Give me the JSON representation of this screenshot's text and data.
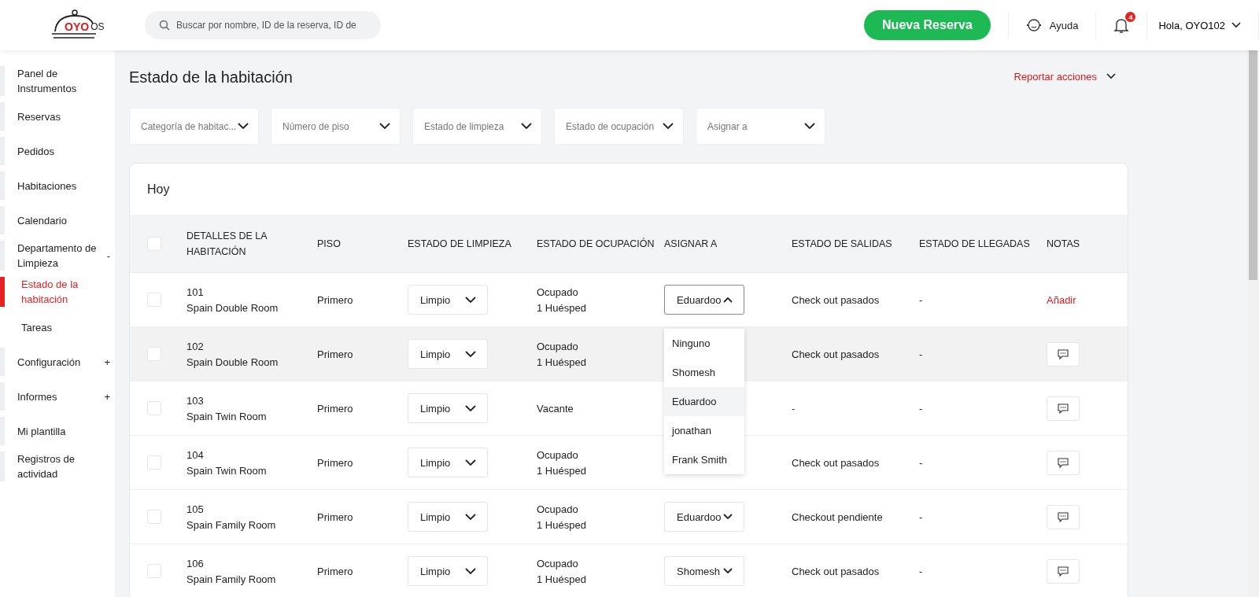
{
  "header": {
    "logo": {
      "brand": "OYO",
      "suffix": "OS"
    },
    "search": {
      "placeholder": "Buscar por nombre, ID de la reserva, ID de"
    },
    "new_booking_button": "Nueva Reserva",
    "help": "Ayuda",
    "notifications": {
      "badge": "4"
    },
    "user_menu": "Hola, OYO102"
  },
  "sidebar": {
    "items": [
      {
        "label": "Panel de Instrumentos",
        "selected": false
      },
      {
        "label": "Reservas",
        "selected": false
      },
      {
        "label": "Pedidos",
        "selected": false
      },
      {
        "label": "Habitaciones",
        "selected": false
      },
      {
        "label": "Calendario",
        "selected": false
      },
      {
        "label": "Departamento de Limpieza",
        "selected": false,
        "toggle": "-",
        "children": [
          {
            "label": "Estado de la habitación",
            "selected": true
          },
          {
            "label": "Tareas",
            "selected": false
          }
        ]
      },
      {
        "label": "Configuración",
        "selected": false,
        "toggle": "+"
      },
      {
        "label": "Informes",
        "selected": false,
        "toggle": "+"
      },
      {
        "label": "Mi plantilla",
        "selected": false
      },
      {
        "label": "Registros de actividad",
        "selected": false
      }
    ]
  },
  "page": {
    "title": "Estado de la habitación",
    "report_actions": "Reportar acciones",
    "filters": [
      {
        "placeholder": "Categoría de habitac..."
      },
      {
        "placeholder": "Número de piso"
      },
      {
        "placeholder": "Estado de limpieza"
      },
      {
        "placeholder": "Estado de ocupación"
      },
      {
        "placeholder": "Asignar a"
      }
    ],
    "card": {
      "title": "Hoy",
      "table": {
        "all_checked": false,
        "columns": [
          "DETALLES DE LA HABITACIÓN",
          "PISO",
          "ESTADO DE LIMPIEZA",
          "ESTADO DE OCUPACIÓN",
          "ASIGNAR A",
          "ESTADO DE SALIDAS",
          "ESTADO DE LLEGADAS",
          "NOTAS"
        ],
        "rows": [
          {
            "checked": false,
            "highlighted": false,
            "room": "101",
            "type": "Spain Double Room",
            "floor": "Primero",
            "cleaning": "Limpio",
            "occupancy": [
              "Ocupado",
              "1 Huésped"
            ],
            "assignee": "Eduardoo",
            "assign_open": true,
            "departures": "Check out pasados",
            "arrivals": "-",
            "notes": {
              "kind": "link",
              "label": "Añadir"
            }
          },
          {
            "checked": false,
            "highlighted": true,
            "room": "102",
            "type": "Spain Double Room",
            "floor": "Primero",
            "cleaning": "Limpio",
            "occupancy": [
              "Ocupado",
              "1 Huésped"
            ],
            "departures": "Check out pasados",
            "arrivals": "-",
            "notes": {
              "kind": "icon"
            }
          },
          {
            "checked": false,
            "highlighted": false,
            "room": "103",
            "type": "Spain Twin Room",
            "floor": "Primero",
            "cleaning": "Limpio",
            "occupancy": [
              "Vacante"
            ],
            "departures": "-",
            "arrivals": "-",
            "notes": {
              "kind": "icon"
            }
          },
          {
            "checked": false,
            "highlighted": false,
            "room": "104",
            "type": "Spain Twin Room",
            "floor": "Primero",
            "cleaning": "Limpio",
            "occupancy": [
              "Ocupado",
              "1 Huésped"
            ],
            "departures": "Check out pasados",
            "arrivals": "-",
            "notes": {
              "kind": "icon"
            }
          },
          {
            "checked": false,
            "highlighted": false,
            "room": "105",
            "type": "Spain Family Room",
            "floor": "Primero",
            "cleaning": "Limpio",
            "occupancy": [
              "Ocupado",
              "1 Huésped"
            ],
            "assignee": "Eduardoo",
            "assign_open": false,
            "departures": "Checkout pendiente",
            "arrivals": "-",
            "notes": {
              "kind": "icon"
            }
          },
          {
            "checked": false,
            "highlighted": false,
            "room": "106",
            "type": "Spain Family Room",
            "floor": "Primero",
            "cleaning": "Limpio",
            "occupancy": [
              "Ocupado",
              "1 Huésped"
            ],
            "assignee": "Shomesh",
            "assign_open": false,
            "departures": "Check out pasados",
            "arrivals": "-",
            "notes": {
              "kind": "icon"
            }
          }
        ]
      },
      "assign_menu": {
        "options": [
          {
            "label": "Ninguno",
            "selected": false
          },
          {
            "label": "Shomesh",
            "selected": false
          },
          {
            "label": "Eduardoo",
            "selected": true
          },
          {
            "label": "jonathan",
            "selected": false
          },
          {
            "label": "Frank Smith",
            "selected": false
          }
        ]
      }
    }
  }
}
